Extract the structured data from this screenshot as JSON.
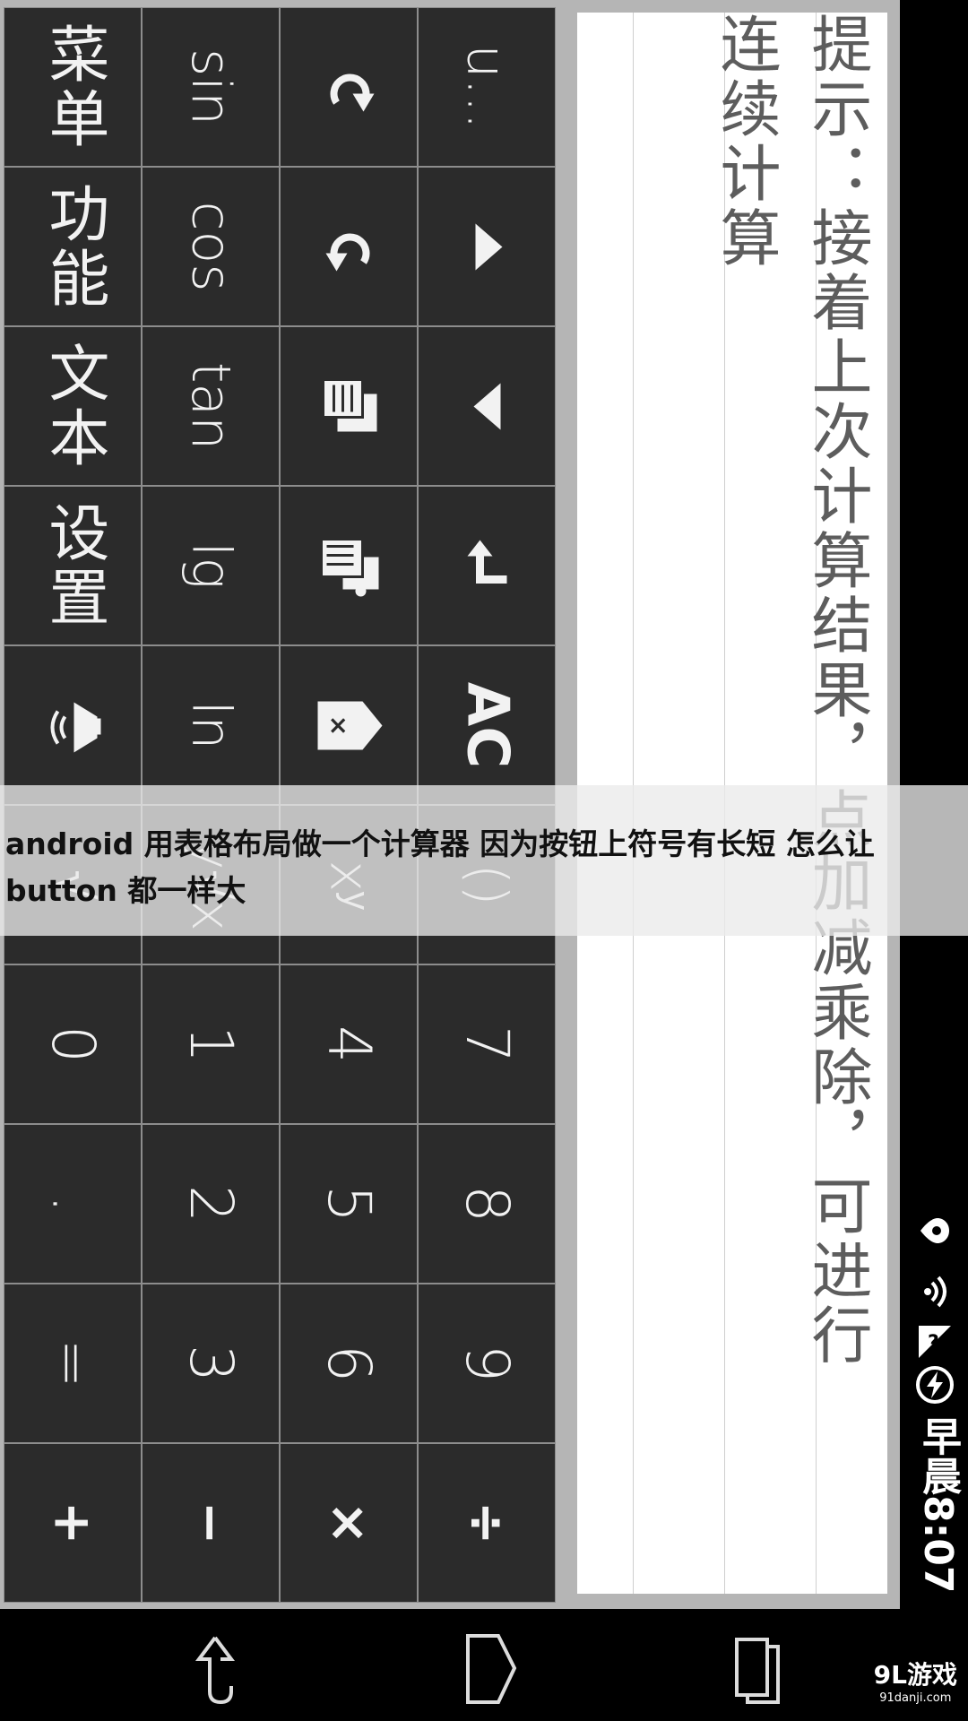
{
  "keypad": [
    {
      "label": "菜单",
      "kind": "cn"
    },
    {
      "label": "sin",
      "kind": "fn"
    },
    {
      "label": "",
      "kind": "icon",
      "icon": "undo-icon"
    },
    {
      "label": "u...",
      "kind": "fn"
    },
    {
      "label": "功能",
      "kind": "cn"
    },
    {
      "label": "cos",
      "kind": "fn"
    },
    {
      "label": "",
      "kind": "icon",
      "icon": "redo-icon"
    },
    {
      "label": "",
      "kind": "icon",
      "icon": "triangle-up-icon"
    },
    {
      "label": "文本",
      "kind": "cn"
    },
    {
      "label": "tan",
      "kind": "fn"
    },
    {
      "label": "",
      "kind": "icon",
      "icon": "copy-icon"
    },
    {
      "label": "",
      "kind": "icon",
      "icon": "triangle-down-icon"
    },
    {
      "label": "设置",
      "kind": "cn"
    },
    {
      "label": "lg",
      "kind": "fn"
    },
    {
      "label": "",
      "kind": "icon",
      "icon": "paste-icon"
    },
    {
      "label": "",
      "kind": "icon",
      "icon": "enter-icon"
    },
    {
      "label": "",
      "kind": "icon",
      "icon": "speaker-icon"
    },
    {
      "label": "ln",
      "kind": "fn"
    },
    {
      "label": "",
      "kind": "icon",
      "icon": "backspace-icon"
    },
    {
      "label": "AC",
      "kind": "ac"
    },
    {
      "label": "√",
      "kind": "fn"
    },
    {
      "label": "y√x",
      "kind": "fn"
    },
    {
      "label": "xʸ",
      "kind": "fn"
    },
    {
      "label": "()",
      "kind": "fn"
    },
    {
      "label": "0",
      "kind": "num"
    },
    {
      "label": "1",
      "kind": "num"
    },
    {
      "label": "4",
      "kind": "num"
    },
    {
      "label": "7",
      "kind": "num"
    },
    {
      "label": ".",
      "kind": "num"
    },
    {
      "label": "2",
      "kind": "num"
    },
    {
      "label": "5",
      "kind": "num"
    },
    {
      "label": "8",
      "kind": "num"
    },
    {
      "label": "=",
      "kind": "num"
    },
    {
      "label": "3",
      "kind": "num"
    },
    {
      "label": "6",
      "kind": "num"
    },
    {
      "label": "9",
      "kind": "num"
    },
    {
      "label": "+",
      "kind": "sym"
    },
    {
      "label": "−",
      "kind": "sym"
    },
    {
      "label": "×",
      "kind": "sym"
    },
    {
      "label": "÷",
      "kind": "sym"
    }
  ],
  "display": {
    "hint_line1": "提示：接着上次计算结果，点加减乘除，可进行",
    "hint_line2": "连续计算"
  },
  "status": {
    "time": "早晨8:07"
  },
  "caption": {
    "text": "android 用表格布局做一个计算器 因为按钮上符号有长短 怎么让button 都一样大"
  },
  "watermark": {
    "brand": "9L游戏",
    "site": "91danji.com"
  },
  "colors": {
    "key_bg": "#2b2b2b",
    "grid_line": "#8d8d8d",
    "hint_text": "#5d5d5d"
  }
}
